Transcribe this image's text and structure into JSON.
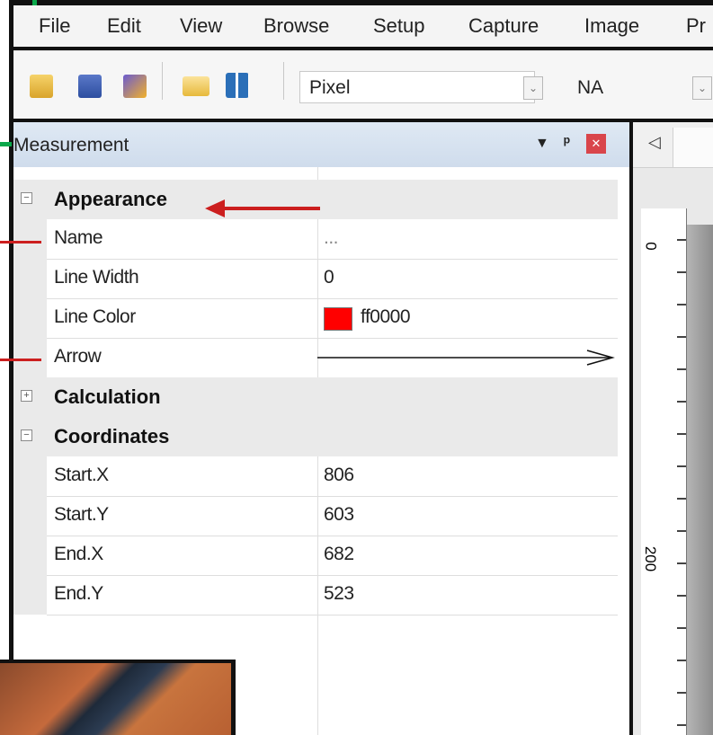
{
  "menu": [
    "File",
    "Edit",
    "View",
    "Browse",
    "Setup",
    "Capture",
    "Image",
    "Pr"
  ],
  "toolbar": {
    "unit_value": "Pixel",
    "na_value": "NA"
  },
  "panel": {
    "title": "Measurement",
    "dropdown_glyph": "▼",
    "pin_glyph": "ᵖ",
    "close_glyph": "✕"
  },
  "tab_glyph": "◁",
  "categories": {
    "appearance": "Appearance",
    "calculation": "Calculation",
    "coordinates": "Coordinates"
  },
  "properties": {
    "name": {
      "label": "Name",
      "value": "..."
    },
    "line_width": {
      "label": "Line Width",
      "value": "0"
    },
    "line_color": {
      "label": "Line Color",
      "value": "ff0000",
      "swatch": "#ff0000"
    },
    "arrow": {
      "label": "Arrow",
      "value": ""
    },
    "start_x": {
      "label": "Start.X",
      "value": "806"
    },
    "start_y": {
      "label": "Start.Y",
      "value": "603"
    },
    "end_x": {
      "label": "End.X",
      "value": "682"
    },
    "end_y": {
      "label": "End.Y",
      "value": "523"
    }
  },
  "ruler": {
    "tick_0": "0",
    "tick_200": "200"
  },
  "expander": {
    "minus": "−",
    "plus": "+"
  },
  "colors": {
    "annotation_red": "#cc1f1f",
    "annotation_green": "#0aa84a",
    "panel_header": "#dfe9f4"
  }
}
